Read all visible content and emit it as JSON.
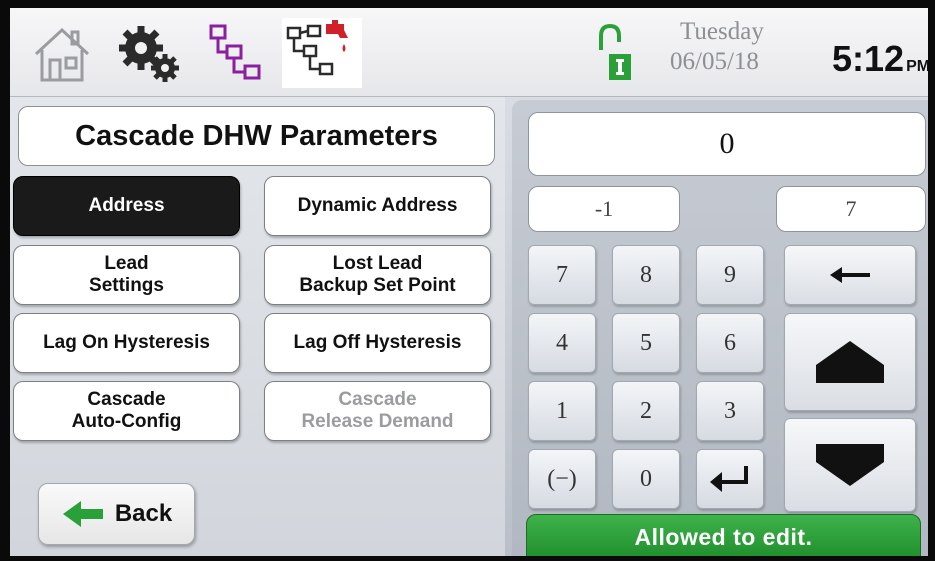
{
  "topbar": {
    "icons": [
      "home-icon",
      "settings-gears-icon",
      "cascade-network-icon",
      "cascade-dhw-network-icon"
    ],
    "day": "Tuesday",
    "date": "06/05/18",
    "time": "5:12",
    "ampm": "PM"
  },
  "page": {
    "title": "Cascade DHW Parameters"
  },
  "params": {
    "address": "Address",
    "dynamic_address": "Dynamic Address",
    "lead_settings_line1": "Lead",
    "lead_settings_line2": "Settings",
    "lost_lead_line1": "Lost Lead",
    "lost_lead_line2": "Backup Set Point",
    "lag_on": "Lag On Hysteresis",
    "lag_off": "Lag Off Hysteresis",
    "auto_config_line1": "Cascade",
    "auto_config_line2": "Auto-Config",
    "release_line1": "Cascade",
    "release_line2": "Release Demand"
  },
  "back": {
    "label": "Back"
  },
  "keypad": {
    "value": "0",
    "min": "-1",
    "max": "7",
    "keys": [
      "7",
      "8",
      "9",
      "4",
      "5",
      "6",
      "1",
      "2",
      "3",
      "(−)",
      "0"
    ],
    "status": "Allowed to edit."
  },
  "colors": {
    "accent_green": "#2aa138",
    "network_purple": "#8a1fa0",
    "faucet_red": "#d0202a"
  }
}
